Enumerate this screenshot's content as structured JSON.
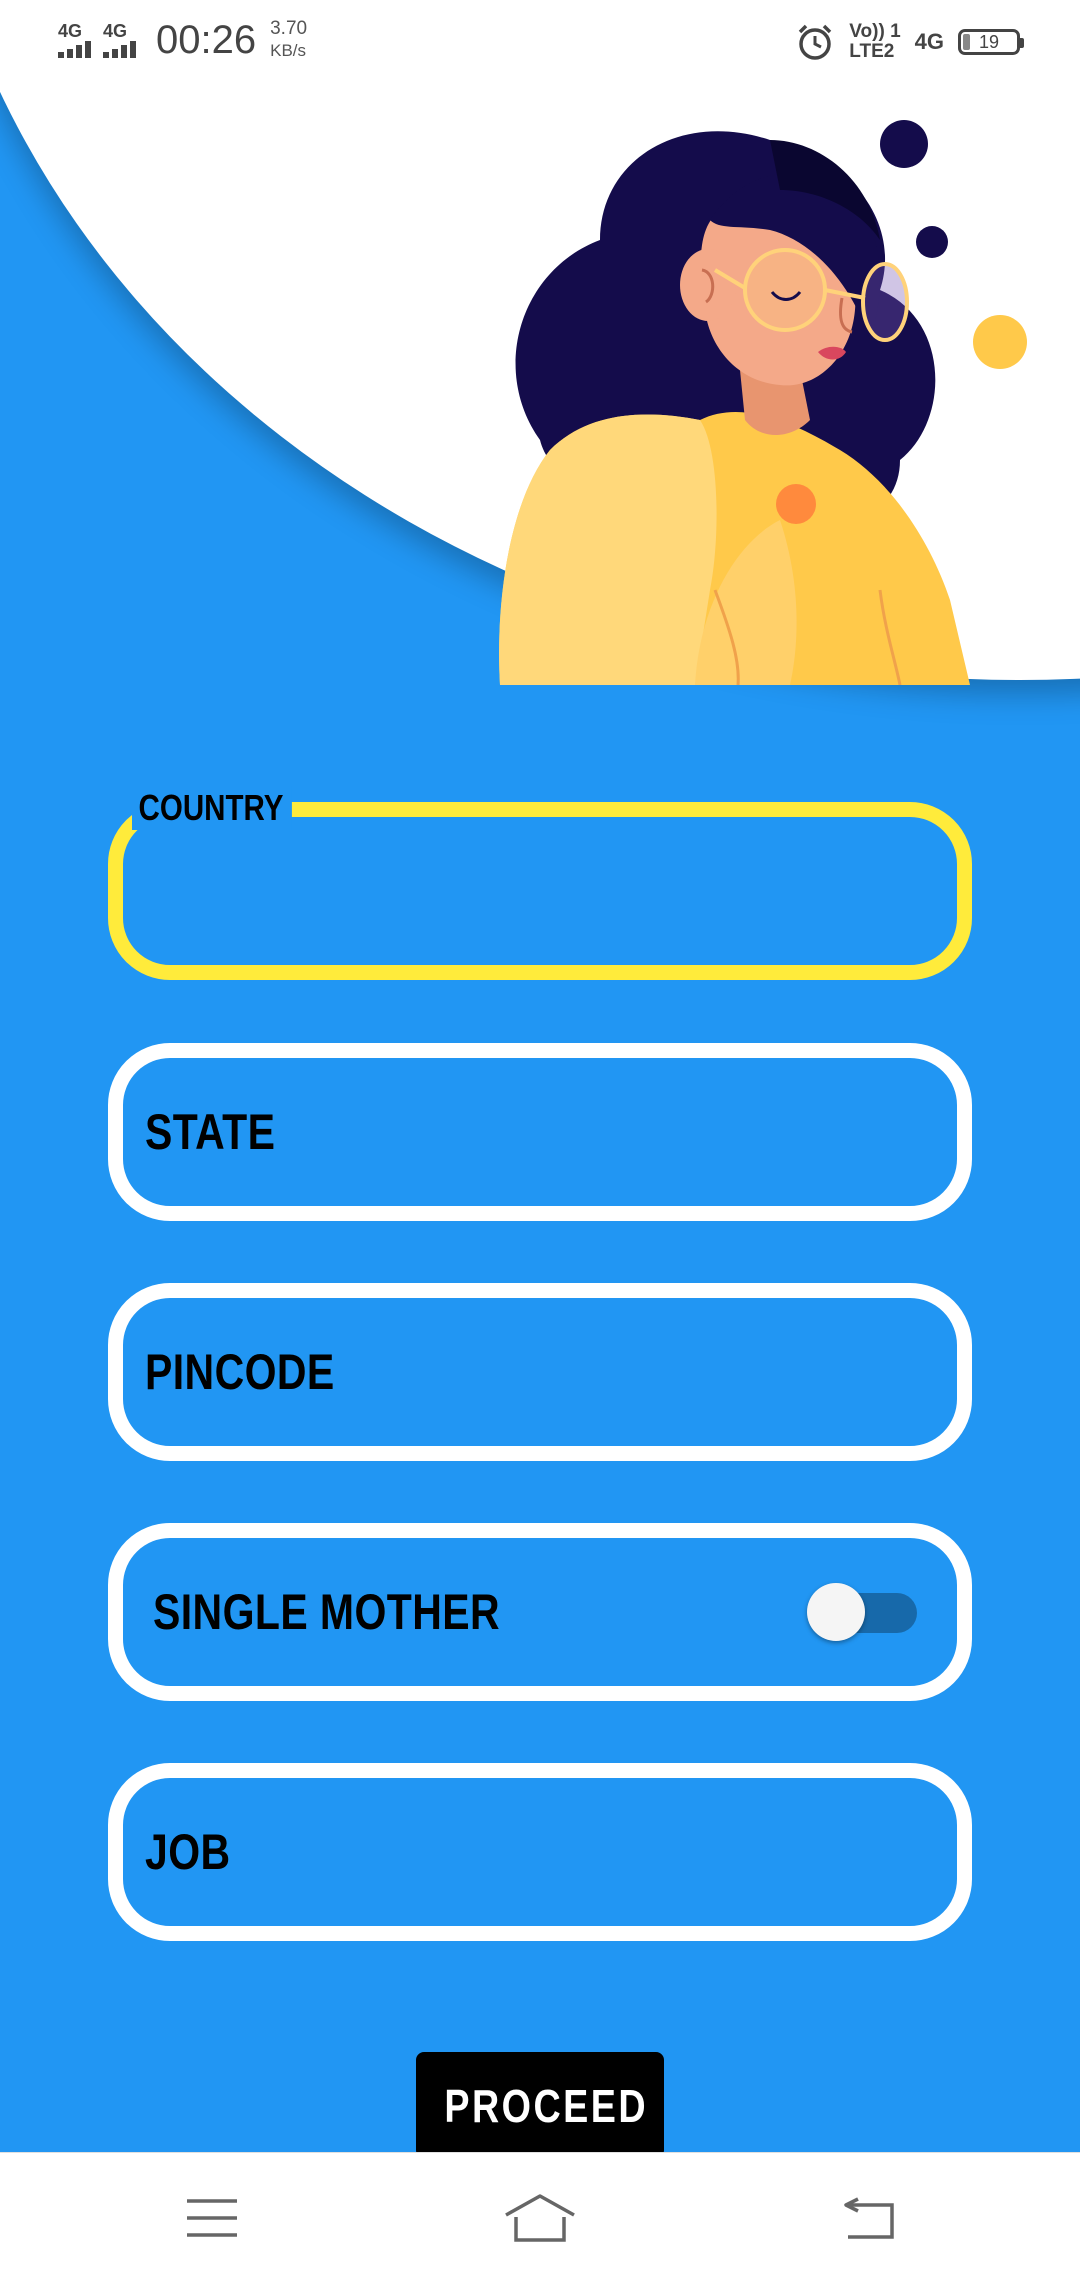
{
  "status_bar": {
    "network_1": "4G",
    "network_2": "4G",
    "time": "00:26",
    "speed_value": "3.70",
    "speed_unit": "KB/s",
    "volte_line1": "Vo)) 1",
    "volte_line2": "LTE2",
    "network_right": "4G",
    "battery": "19",
    "icons": [
      "signal-icon",
      "alarm-icon",
      "battery-icon"
    ]
  },
  "form": {
    "fields": [
      {
        "label": "COUNTRY",
        "value": "",
        "focused": true
      },
      {
        "label": "STATE",
        "value": ""
      },
      {
        "label": "PINCODE",
        "value": ""
      },
      {
        "label": "SINGLE MOTHER",
        "type": "toggle",
        "checked": false
      },
      {
        "label": "JOB",
        "value": ""
      }
    ],
    "proceed_label": "PROCEED"
  },
  "colors": {
    "background": "#2196F3",
    "focus_border": "#FFEB3B",
    "field_border": "#FFFFFF",
    "button": "#000000"
  },
  "nav_bar": {
    "icons": [
      "menu-icon",
      "home-icon",
      "back-icon"
    ]
  }
}
